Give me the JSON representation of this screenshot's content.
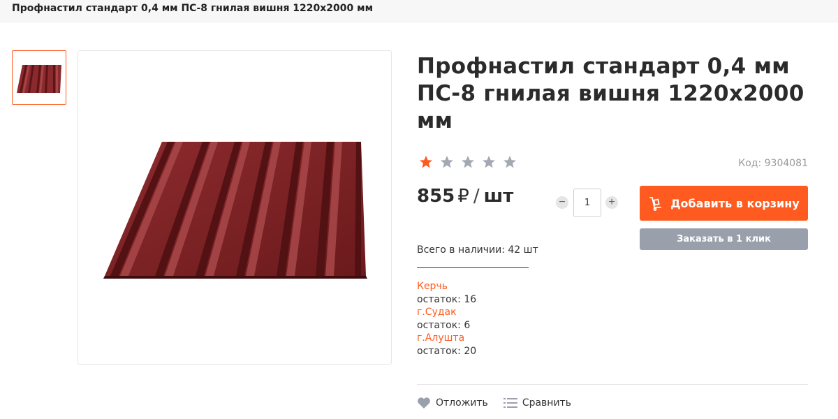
{
  "breadcrumb": {
    "title": "Профнастил стандарт 0,4 мм ПС-8 гнилая вишня 1220х2000 мм"
  },
  "gallery": {
    "thumb_icon": "corrugated-sheet-image",
    "main_icon": "corrugated-sheet-image",
    "product_color": "#7a1f22"
  },
  "product": {
    "title": "Профнастил стандарт 0,4 мм ПС-8 гнилая вишня 1220х2000 мм",
    "code": "Код: 9304081",
    "rating": {
      "value": 1,
      "max": 5,
      "active_color": "#ff5a1f",
      "inactive_color": "#a3a8b3"
    },
    "price": {
      "amount": "855",
      "currency": "₽",
      "separator": "/",
      "unit": "шт"
    },
    "quantity": {
      "value": "1",
      "minus": "−",
      "plus": "+"
    },
    "buttons": {
      "add_to_cart": "Добавить в корзину",
      "one_click": "Заказать в 1 клик"
    },
    "stock": {
      "total": "Всего в наличии: 42 шт",
      "stores": [
        {
          "city": "Керчь",
          "remainder": "остаток: 16"
        },
        {
          "city": "г.Судак",
          "remainder": "остаток: 6"
        },
        {
          "city": "г.Алушта",
          "remainder": "остаток: 20"
        }
      ]
    },
    "actions": {
      "wishlist": "Отложить",
      "compare": "Сравнить"
    }
  },
  "colors": {
    "accent": "#ff5a1f",
    "secondary_button": "#9aa0ab"
  }
}
